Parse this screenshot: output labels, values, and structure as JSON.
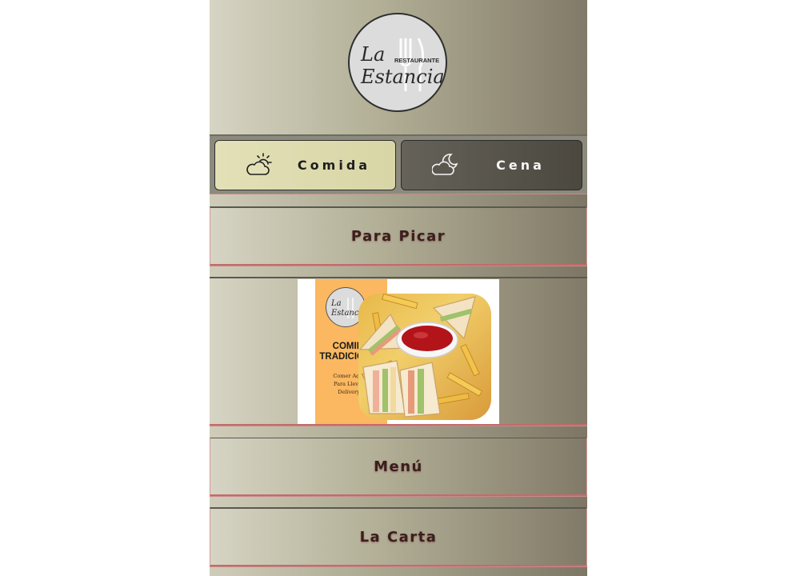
{
  "brand": {
    "logo_line1": "La",
    "logo_badge": "RESTAURANTE",
    "logo_line2": "Estancia"
  },
  "tabs": [
    {
      "label": "Comida",
      "icon": "sun-behind-cloud-icon",
      "active": true
    },
    {
      "label": "Cena",
      "icon": "moon-behind-cloud-icon",
      "active": false
    }
  ],
  "sections": {
    "para_picar": "Para Picar",
    "menu": "Menú",
    "la_carta": "La Carta"
  },
  "banner": {
    "logo_line1": "La",
    "logo_line2": "Estancia",
    "title_line1": "COMIDA",
    "title_line2": "TRADICIONAL",
    "options": [
      "Comer Aqui",
      "Para Llevar",
      "Delivery"
    ]
  },
  "colors": {
    "tab_comida_bg": "#dfdcae",
    "tab_cena_bg": "#55524a",
    "label_text": "#3a1f1f",
    "banner_orange": "#fbb860",
    "ketchup": "#b3141a"
  }
}
